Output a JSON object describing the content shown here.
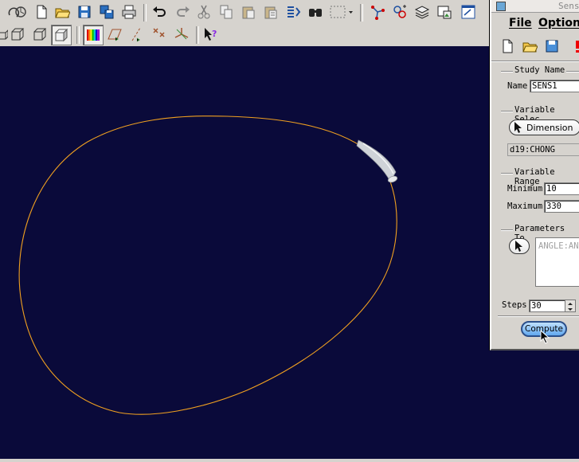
{
  "toolbar": {
    "row1_icons": [
      "regenerate-icon",
      "redo-regen-icon",
      "new-file-icon",
      "open-folder-icon",
      "save-icon",
      "save-copy-icon",
      "print-icon",
      "undo-icon",
      "redo-icon",
      "cut-icon",
      "copy-icon",
      "paste-icon",
      "paste-special-icon",
      "repaint-icon",
      "find-icon",
      "view-dropdown-icon",
      "datum-icon",
      "model-tree-icon",
      "layers-icon",
      "image-icon",
      "window-icon"
    ],
    "row2_icons": [
      "wireframe-cube-icon",
      "hidden-line-cube-icon",
      "no-hidden-cube-icon",
      "shaded-cube-icon",
      "spectrum-icon",
      "datum-planes-icon",
      "datum-axes-icon",
      "datum-points-icon",
      "coord-sys-icon",
      "whats-this-icon"
    ]
  },
  "dialog": {
    "title": "Sens",
    "menu": {
      "file": "File",
      "options": "Options"
    },
    "tool_icons": [
      "new-doc-icon",
      "open-folder-icon",
      "save-icon",
      "alert-icon"
    ],
    "study_name": {
      "legend": "Study Name",
      "label": "Name",
      "value": "SENS1"
    },
    "variable_selection": {
      "legend": "Variable Selec",
      "button": "Dimension",
      "value": "d19:CHONG"
    },
    "variable_range": {
      "legend": "Variable Range",
      "min_label": "Minimum",
      "min_value": "10",
      "max_label": "Maximum",
      "max_value": "330"
    },
    "parameters": {
      "legend": "Parameters To",
      "list_value": "ANGLE:ANA"
    },
    "steps": {
      "label": "Steps",
      "value": "30"
    },
    "compute_label": "Compute"
  },
  "colors": {
    "viewport_bg": "#0a0a3a",
    "curve": "#f0a020",
    "dialog_bg": "#d6d3ce",
    "compute": "#62a8ef"
  }
}
